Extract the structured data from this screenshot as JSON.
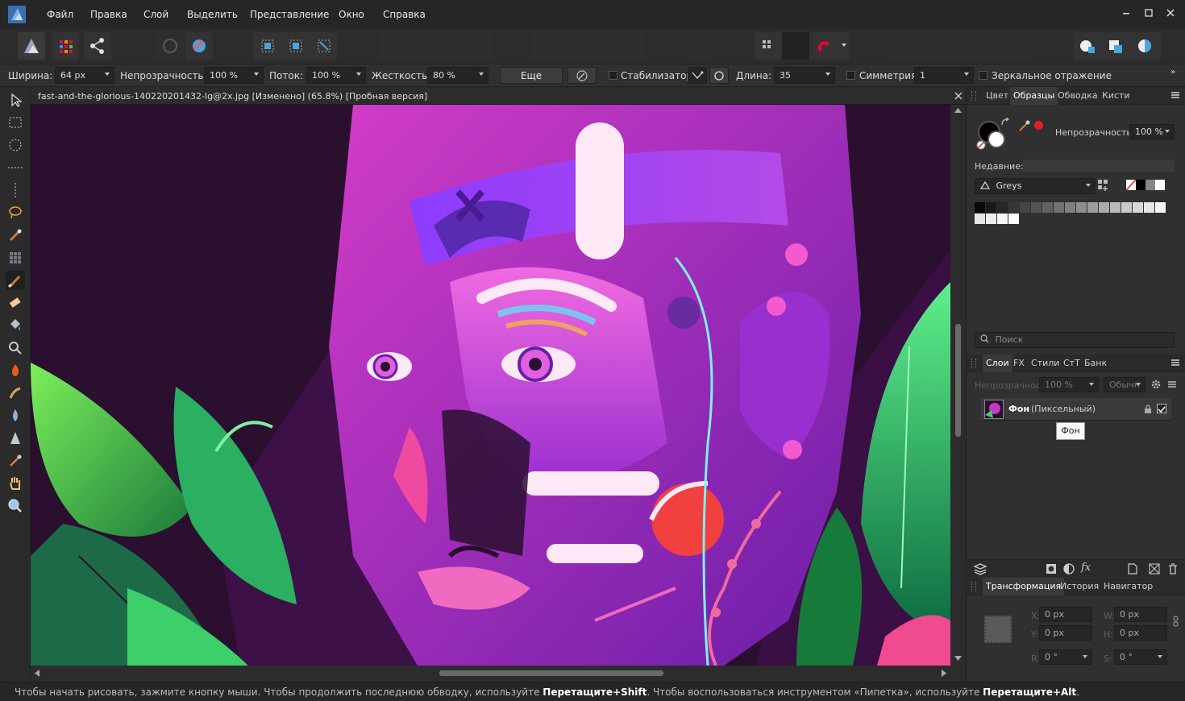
{
  "menu": {
    "items": [
      "Файл",
      "Правка",
      "Слой",
      "Выделить",
      "Представление",
      "Окно",
      "Справка"
    ]
  },
  "context_bar": {
    "width_label": "Ширина:",
    "width_value": "64 px",
    "opacity_label": "Непрозрачность:",
    "opacity_value": "100 %",
    "flow_label": "Поток:",
    "flow_value": "100 %",
    "hardness_label": "Жесткость:",
    "hardness_value": "80 %",
    "more_button": "Еще",
    "stabilizer_label": "Стабилизатор",
    "length_label": "Длина:",
    "length_value": "35",
    "symmetry_label": "Симметрия",
    "symmetry_value": "1",
    "mirror_label": "Зеркальное отражение"
  },
  "document": {
    "title": "fast-and-the-glorious-140220201432-lg@2x.jpg [Изменено] (65.8%) [Пробная версия]"
  },
  "status": {
    "part1": "Чтобы начать рисовать, зажмите кнопку мыши. Чтобы продолжить последнюю обводку, используйте ",
    "bold1": "Перетащите+Shift",
    "part2": ". Чтобы воспользоваться инструментом «Пипетка», используйте ",
    "bold2": "Перетащите+Alt",
    "part3": "."
  },
  "swatches_panel": {
    "tabs": [
      "Цвет",
      "Образцы",
      "Обводка",
      "Кисти"
    ],
    "active_tab": "Образцы",
    "opacity_label": "Непрозрачность:",
    "opacity_value": "100 %",
    "recent_label": "Недавние:",
    "palette_name": "Greys",
    "search_placeholder": "Поиск"
  },
  "layers_panel": {
    "tabs": [
      "Слои",
      "FX",
      "Стили",
      "СтТ",
      "Банк"
    ],
    "active_tab": "Слои",
    "opacity_value": "100 %",
    "blend_mode": "Обычн",
    "layer_name": "Фон",
    "layer_type": "(Пиксельный)",
    "tooltip": "Фон"
  },
  "transform_panel": {
    "tabs": [
      "Трансформация",
      "История",
      "Навигатор"
    ],
    "active_tab": "Трансформация",
    "x_label": "X:",
    "y_label": "Y:",
    "w_label": "W:",
    "h_label": "H:",
    "r_label": "R:",
    "s_label": "S:",
    "x_value": "0 px",
    "y_value": "0 px",
    "w_value": "0 px",
    "h_value": "0 px",
    "r_value": "0 °",
    "s_value": "0 °"
  },
  "colors": {
    "accent": "#4aa3df",
    "canvas_bg": "#2a0f2f",
    "primary_color": "#000000",
    "secondary_color": "#ffffff"
  }
}
